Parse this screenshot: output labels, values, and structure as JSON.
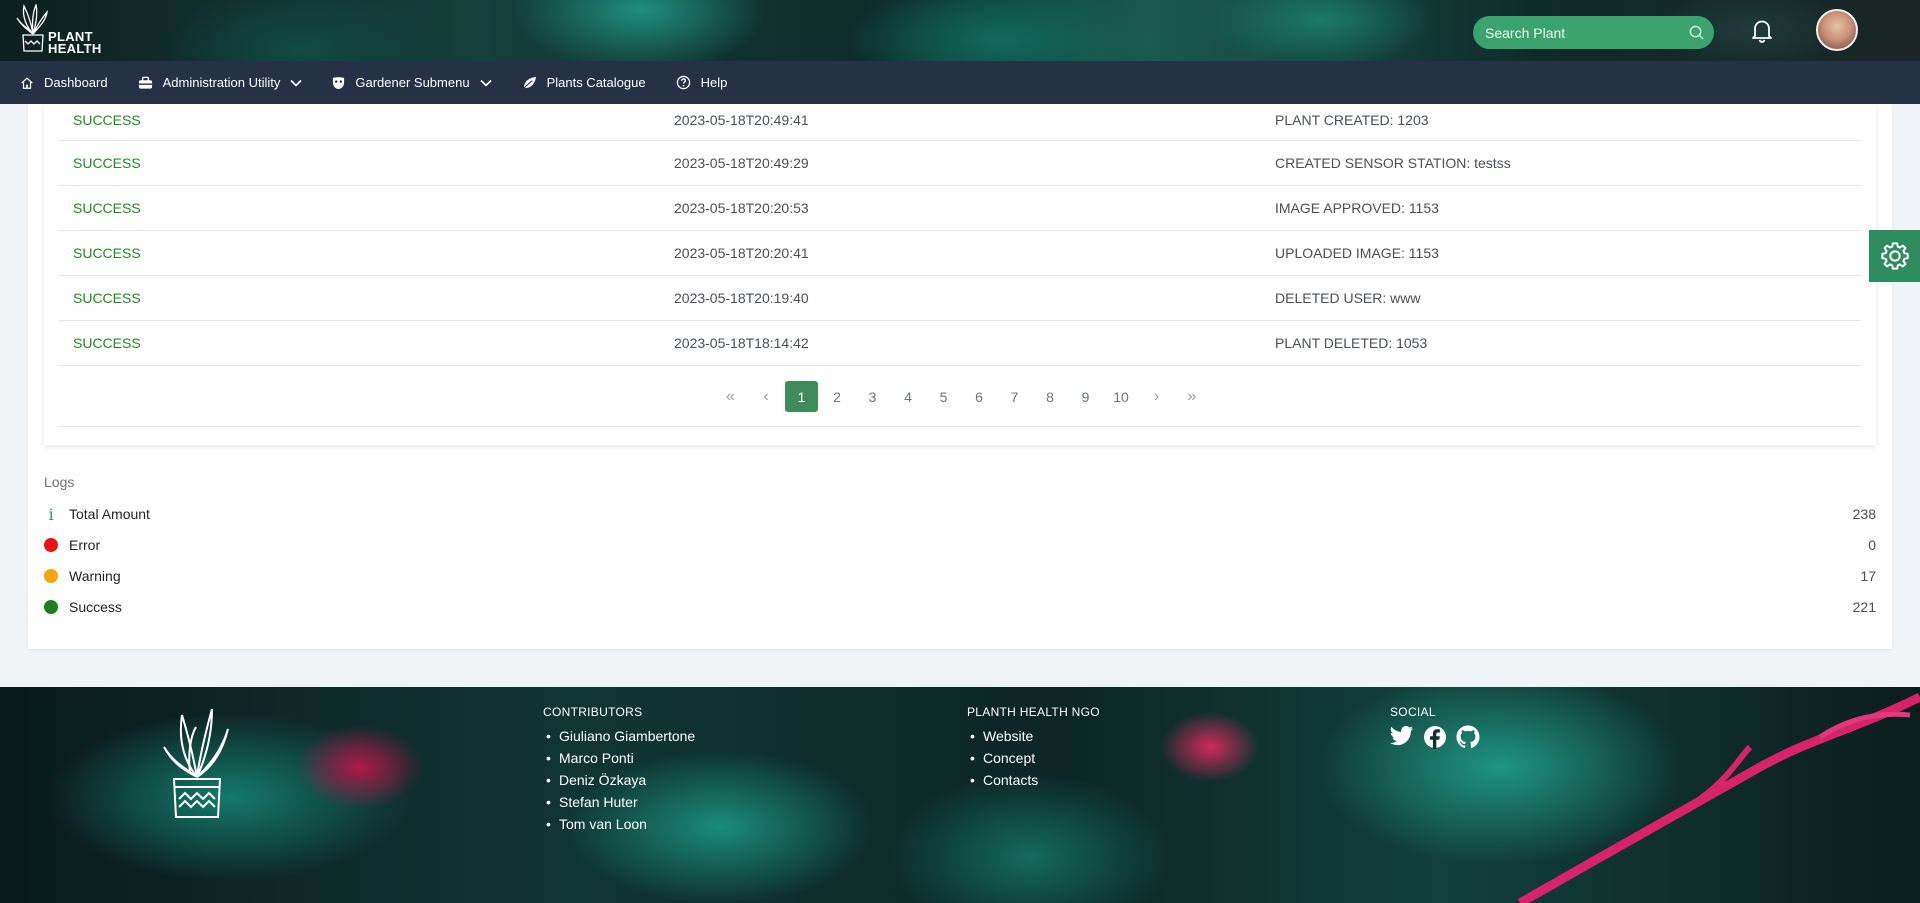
{
  "header": {
    "logo_line1": "PLANT",
    "logo_line2": "HEALTH",
    "search_placeholder": "Search Plant"
  },
  "nav": {
    "items": [
      {
        "label": "Dashboard",
        "icon": "home-icon"
      },
      {
        "label": "Administration Utility",
        "icon": "toolbox-icon",
        "dropdown": true
      },
      {
        "label": "Gardener Submenu",
        "icon": "mask-icon",
        "dropdown": true
      },
      {
        "label": "Plants Catalogue",
        "icon": "leaf-icon"
      },
      {
        "label": "Help",
        "icon": "question-circle-icon"
      }
    ]
  },
  "table": {
    "rows": [
      {
        "status": "SUCCESS",
        "time": "2023-05-18T20:49:41",
        "message": "PLANT CREATED: 1203"
      },
      {
        "status": "SUCCESS",
        "time": "2023-05-18T20:49:29",
        "message": "CREATED SENSOR STATION: testss"
      },
      {
        "status": "SUCCESS",
        "time": "2023-05-18T20:20:53",
        "message": "IMAGE APPROVED: 1153"
      },
      {
        "status": "SUCCESS",
        "time": "2023-05-18T20:20:41",
        "message": "UPLOADED IMAGE: 1153"
      },
      {
        "status": "SUCCESS",
        "time": "2023-05-18T20:19:40",
        "message": "DELETED USER: www"
      },
      {
        "status": "SUCCESS",
        "time": "2023-05-18T18:14:42",
        "message": "PLANT DELETED: 1053"
      }
    ]
  },
  "pagination": {
    "first": "«",
    "prev": "‹",
    "pages": [
      "1",
      "2",
      "3",
      "4",
      "5",
      "6",
      "7",
      "8",
      "9",
      "10"
    ],
    "current": "1",
    "next": "›",
    "last": "»"
  },
  "logs": {
    "title": "Logs",
    "items": [
      {
        "label": "Total Amount",
        "count": "238",
        "indicator": "info-icon",
        "color": "#2a9d5c"
      },
      {
        "label": "Error",
        "count": "0",
        "indicator": "dot",
        "color": "#e8141a"
      },
      {
        "label": "Warning",
        "count": "17",
        "indicator": "dot",
        "color": "#f5a40c"
      },
      {
        "label": "Success",
        "count": "221",
        "indicator": "dot",
        "color": "#1f7f1f"
      }
    ]
  },
  "footer": {
    "contributors": {
      "title": "CONTRIBUTORS",
      "items": [
        "Giuliano Giambertone",
        "Marco Ponti",
        "Deniz Özkaya",
        "Stefan Huter",
        "Tom van Loon"
      ]
    },
    "ngo": {
      "title": "PLANTH HEALTH NGO",
      "items": [
        "Website",
        "Concept",
        "Contacts"
      ]
    },
    "social": {
      "title": "SOCIAL",
      "icons": [
        "twitter-icon",
        "facebook-icon",
        "github-icon"
      ]
    }
  },
  "colors": {
    "nav_bg": "#253246",
    "accent": "#3d8c5a",
    "success_text": "#1f8b1f",
    "search_bg": "#3ba46e",
    "settings_tab": "#2f8c5f"
  }
}
